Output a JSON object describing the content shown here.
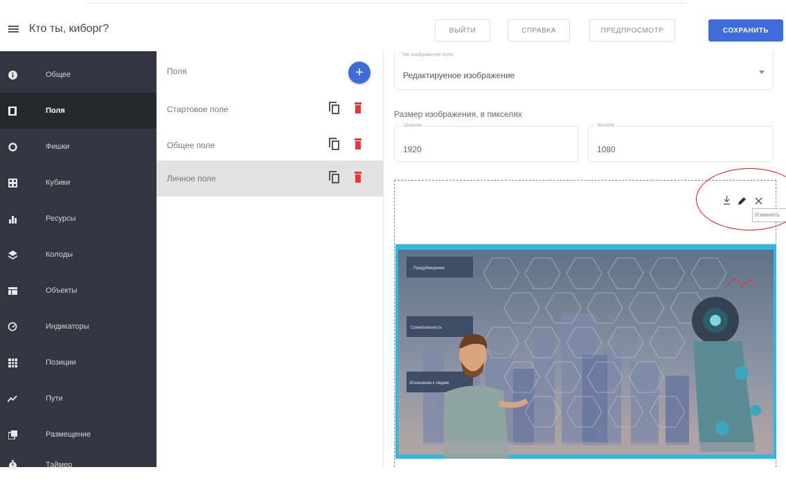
{
  "header": {
    "title": "Кто ты, киборг?",
    "buttons": {
      "exit": "ВЫЙТИ",
      "help": "СПРАВКА",
      "preview": "ПРЕДПРОСМОТР",
      "save": "СОХРАНИТЬ"
    }
  },
  "sidebar": {
    "items": [
      {
        "label": "Общее",
        "icon": "info-icon"
      },
      {
        "label": "Поля",
        "icon": "board-icon"
      },
      {
        "label": "Фишки",
        "icon": "circle-icon"
      },
      {
        "label": "Кубики",
        "icon": "dice-icon"
      },
      {
        "label": "Ресурсы",
        "icon": "bar-chart-icon"
      },
      {
        "label": "Колоды",
        "icon": "layers-icon"
      },
      {
        "label": "Объекты",
        "icon": "objects-icon"
      },
      {
        "label": "Индикаторы",
        "icon": "gauge-icon"
      },
      {
        "label": "Позиции",
        "icon": "grid-icon"
      },
      {
        "label": "Пути",
        "icon": "path-icon"
      },
      {
        "label": "Размещение",
        "icon": "placement-icon"
      },
      {
        "label": "Таймер",
        "icon": "timer-icon"
      }
    ],
    "active_index": 1
  },
  "fields_list": {
    "header_label": "Поля",
    "items": [
      {
        "label": "Стартовое поле"
      },
      {
        "label": "Общее поле"
      },
      {
        "label": "Личное поле"
      }
    ],
    "selected_index": 2
  },
  "editor": {
    "image_type": {
      "label": "Тип изображения поля",
      "value": "Редактируеное изображение"
    },
    "size_title": "Размер изображения, в пикселях",
    "width": {
      "label": "Ширина",
      "value": "1920"
    },
    "height": {
      "label": "Высота",
      "value": "1080"
    },
    "tooltip": "Изменить",
    "board_labels": [
      "Предубеждения",
      "Сознательность",
      "Отношения к людям"
    ]
  },
  "colors": {
    "accent": "#3f6cd9",
    "sidebar_bg": "#333640",
    "sidebar_active": "#25272e",
    "delete": "#e53935",
    "highlight_circle": "#e11111"
  }
}
